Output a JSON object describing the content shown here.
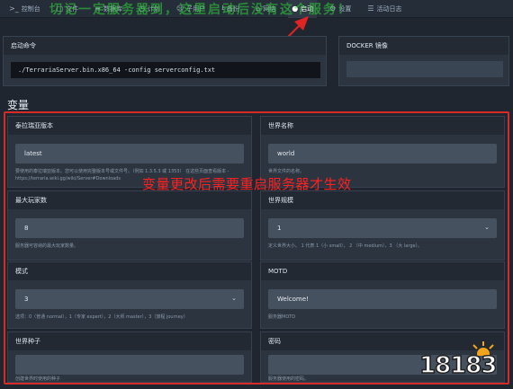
{
  "topbar": {
    "tabs": [
      {
        "label": "控制台",
        "icon": ">_",
        "active": false
      },
      {
        "label": "文件",
        "icon": "▢",
        "active": false
      },
      {
        "label": "数据库",
        "icon": "≡",
        "active": false
      },
      {
        "label": "计划",
        "icon": "◷",
        "active": false
      },
      {
        "label": "子用户",
        "icon": "☺",
        "active": false
      },
      {
        "label": "备份",
        "icon": "⭳",
        "active": false
      },
      {
        "label": "网络",
        "icon": "⌂",
        "active": false
      },
      {
        "label": "启动",
        "icon": "●",
        "active": true
      },
      {
        "label": "设置",
        "icon": "⚙",
        "active": false
      },
      {
        "label": "活动日志",
        "icon": "☰",
        "active": false
      }
    ]
  },
  "overlay_banner": "切记一定服务器到，这里启动后没有这个服务！",
  "startup": {
    "title": "启动命令",
    "command": "./TerrariaServer.bin.x86_64 -config serverconfig.txt"
  },
  "docker": {
    "title": "DOCKER 镜像"
  },
  "variables_title": "变量",
  "warning": "变量更改后需要重启服务器才生效",
  "cards": [
    {
      "title": "泰拉瑞亚版本",
      "value": "latest",
      "desc": "要使用的泰拉瑞亚版本。您可以使用完整版本号或文件号。（例如 1.3.5.3 或 1353） 在这些页面查看版本 - https://terraria.wiki.gg/wiki/Server#Downloads"
    },
    {
      "title": "世界名称",
      "value": "world",
      "desc": "世界文件的名称。"
    },
    {
      "title": "最大玩家数",
      "value": "8",
      "desc": "服务器可容纳的最大玩家数量。"
    },
    {
      "title": "世界规模",
      "value": "1",
      "desc": "定义世界大小。 1 代表 1（小 small）， 2 （中 medium），3 （大 large）。"
    },
    {
      "title": "模式",
      "value": "3",
      "desc": "选项：0（普通 normal），1（专家 expert），2（大师 master），3（旅程 journey）"
    },
    {
      "title": "MOTD",
      "value": "Welcome!",
      "desc": "服务器MOTD"
    },
    {
      "title": "世界种子",
      "value": "",
      "desc": "创建世界时使用的种子"
    },
    {
      "title": "密码",
      "value": "",
      "desc": "服务器使用的密码。"
    }
  ],
  "logo": {
    "text": "18183"
  }
}
